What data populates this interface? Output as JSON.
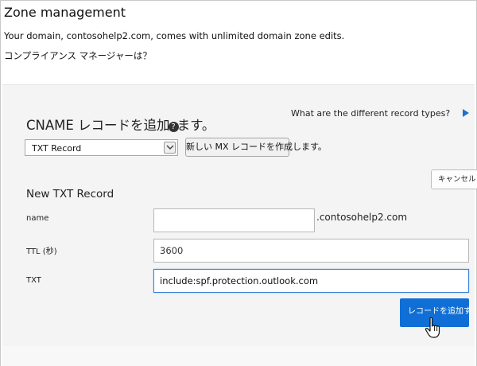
{
  "header": {
    "title": "Zone management",
    "intro_text": "Your domain, contosohelp2.com, comes with unlimited domain zone edits.",
    "faq_link": "コンプライアンス マネージャーは？"
  },
  "panel": {
    "section_title_before": "CNAME レコードを追加",
    "section_title_after": "ます。",
    "help_icon": "question-circle-icon",
    "record_types_link": "What are the different record types?",
    "record_types_arrow_icon": "triangle-right-icon",
    "record_type_select": {
      "value": "TXT Record",
      "icon": "chevron-down-icon"
    },
    "create_mx_button": "新しい MX レコードを作成します。",
    "cancel_button": "キャンセル",
    "form": {
      "title": "New TXT Record",
      "name_label": "name",
      "name_value": "",
      "domain_suffix": ".contosohelp2.com",
      "ttl_label": "TTL (秒)",
      "ttl_value": "3600",
      "txt_label": "TXT",
      "txt_value": "include:spf.protection.outlook.com"
    },
    "add_record_button": "レコードを追加する"
  },
  "colors": {
    "accent": "#0f6fd6",
    "panel_background": "#f4f4f4"
  },
  "cursor_icon": "hand-pointer-icon"
}
